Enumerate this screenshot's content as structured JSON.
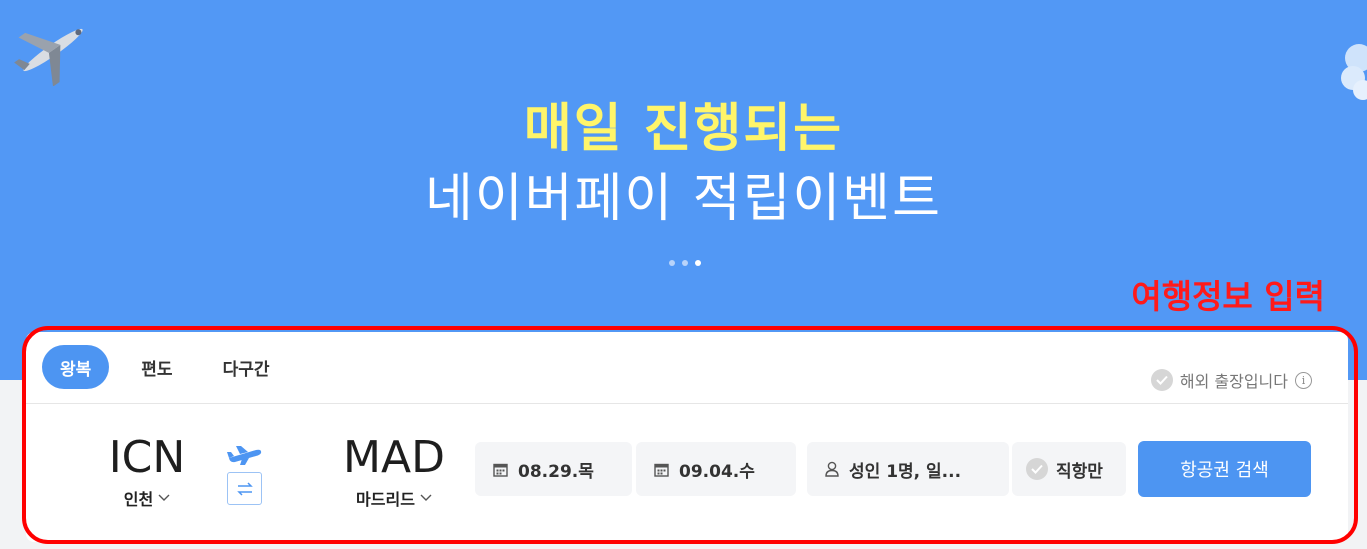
{
  "banner": {
    "title_line1": "매일 진행되는",
    "title_line2": "네이버페이 적립이벤트",
    "slide_count": 3,
    "active_slide": 3
  },
  "annotation": {
    "label": "여행정보 입력",
    "color": "#ff0000"
  },
  "trip_tabs": [
    {
      "label": "왕복",
      "selected": true
    },
    {
      "label": "편도",
      "selected": false
    },
    {
      "label": "다구간",
      "selected": false
    }
  ],
  "business_trip": {
    "label": "해외 출장입니다",
    "info_icon": "i"
  },
  "departure": {
    "code": "ICN",
    "city": "인천"
  },
  "arrival": {
    "code": "MAD",
    "city": "마드리드"
  },
  "dates": {
    "depart": "08.29.목",
    "return": "09.04.수"
  },
  "passengers": {
    "label": "성인 1명, 일..."
  },
  "direct_only": {
    "label": "직항만"
  },
  "search_button": {
    "label": "항공권 검색"
  },
  "colors": {
    "hero_bg": "#5298f5",
    "title_highlight": "#fff56a",
    "accent": "#4d95f2"
  }
}
